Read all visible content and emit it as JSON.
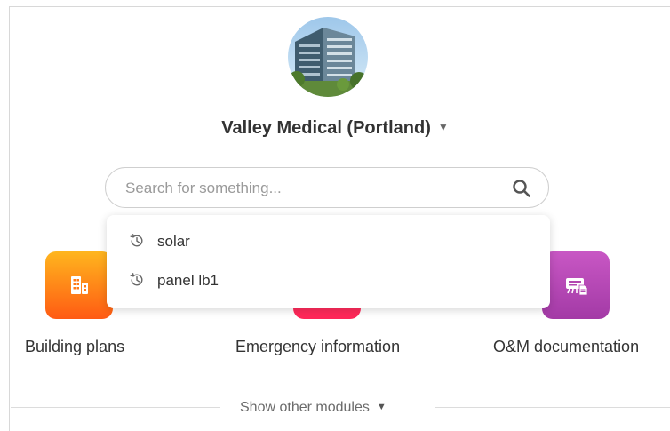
{
  "site": {
    "name": "Valley Medical (Portland)",
    "caret": "▼"
  },
  "search": {
    "placeholder": "Search for something...",
    "value": ""
  },
  "recent_searches": [
    {
      "label": "solar",
      "icon": "history-icon"
    },
    {
      "label": "panel lb1",
      "icon": "history-icon"
    }
  ],
  "modules": [
    {
      "label": "Building plans",
      "icon": "building-icon",
      "color": "#ff7a16"
    },
    {
      "label": "Emergency information",
      "icon": "emergency-icon",
      "color": "#ff2f5f"
    },
    {
      "label": "O&M documentation",
      "icon": "om-document-icon",
      "color": "#b447b1"
    }
  ],
  "footer": {
    "other_modules_label": "Show other modules",
    "caret": "▼"
  }
}
